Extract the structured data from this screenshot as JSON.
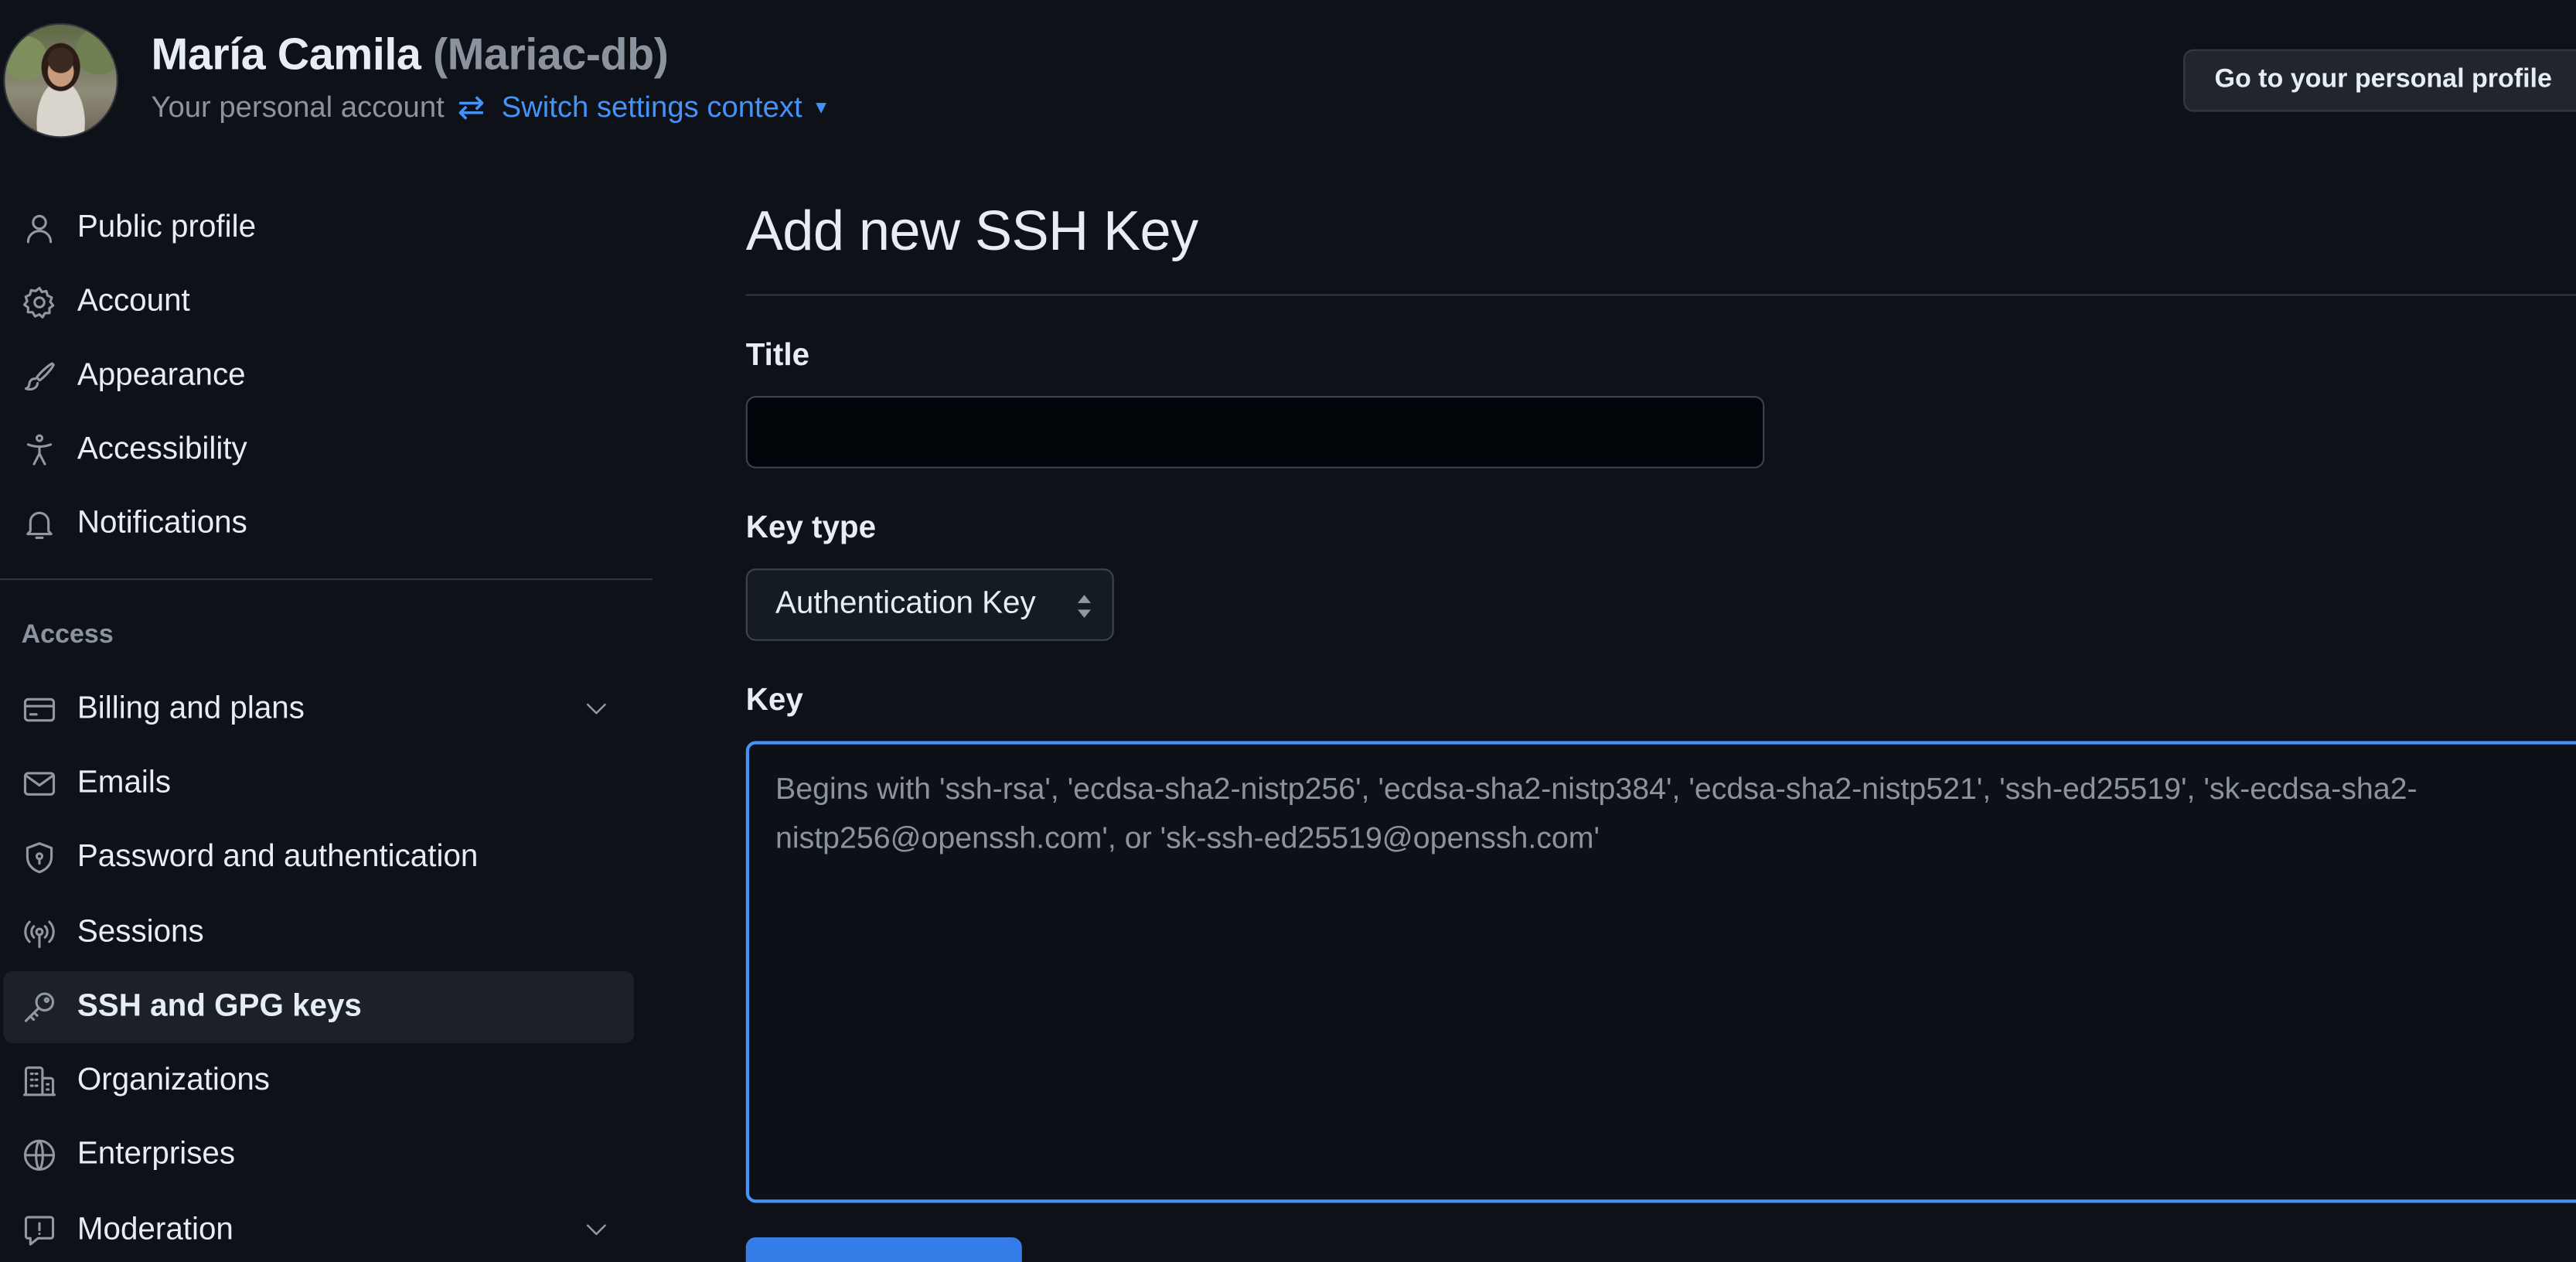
{
  "header": {
    "owner_name": "María Camila",
    "owner_login": "(Mariac-db)",
    "account_label": "Your personal account",
    "switch_context_label": "Switch settings context",
    "profile_button_label": "Go to your personal profile"
  },
  "sidebar": {
    "items": [
      {
        "label": "Public profile",
        "icon": "person-icon"
      },
      {
        "label": "Account",
        "icon": "gear-icon"
      },
      {
        "label": "Appearance",
        "icon": "paintbrush-icon"
      },
      {
        "label": "Accessibility",
        "icon": "accessibility-icon"
      },
      {
        "label": "Notifications",
        "icon": "bell-icon"
      }
    ],
    "access_heading": "Access",
    "access_items": [
      {
        "label": "Billing and plans",
        "icon": "credit-card-icon",
        "expandable": true
      },
      {
        "label": "Emails",
        "icon": "mail-icon"
      },
      {
        "label": "Password and authentication",
        "icon": "shield-lock-icon"
      },
      {
        "label": "Sessions",
        "icon": "broadcast-icon"
      },
      {
        "label": "SSH and GPG keys",
        "icon": "key-icon",
        "active": true
      },
      {
        "label": "Organizations",
        "icon": "organization-icon"
      },
      {
        "label": "Enterprises",
        "icon": "globe-icon"
      },
      {
        "label": "Moderation",
        "icon": "report-icon",
        "expandable": true
      }
    ]
  },
  "main": {
    "page_title": "Add new SSH Key",
    "title_field": {
      "label": "Title",
      "value": "",
      "placeholder": ""
    },
    "key_type_field": {
      "label": "Key type",
      "selected": "Authentication Key"
    },
    "key_field": {
      "label": "Key",
      "placeholder": "Begins with 'ssh-rsa', 'ecdsa-sha2-nistp256', 'ecdsa-sha2-nistp384', 'ecdsa-sha2-nistp521', 'ssh-ed25519', 'sk-ecdsa-sha2-nistp256@openssh.com', or 'sk-ssh-ed25519@openssh.com'"
    },
    "submit_label": ""
  },
  "colors": {
    "background": "#0e1117",
    "accent": "#4493f8",
    "primary_button": "#347ce8",
    "border": "#30363d",
    "muted_text": "#8b949e"
  }
}
